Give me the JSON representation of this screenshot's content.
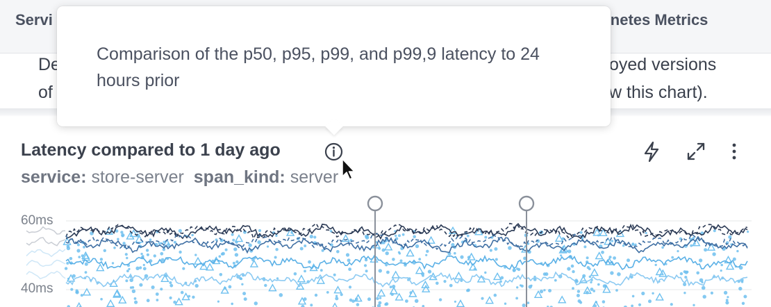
{
  "header": {
    "tab_left": "Servi",
    "tab_right": "ernetes Metrics"
  },
  "description": {
    "line1_left": "De",
    "line2_left": "of",
    "line1_right": "oyed versions",
    "line2_right": "w this chart)."
  },
  "tooltip": {
    "text": "Comparison of the p50, p95, p99, and p99,9 latency to 24 hours prior"
  },
  "panel": {
    "title": "Latency compared to 1 day ago",
    "filters": [
      {
        "key": "service:",
        "value": "store-server"
      },
      {
        "key": "span_kind:",
        "value": "server"
      }
    ],
    "icons": [
      "info-icon",
      "lightning-icon",
      "expand-icon",
      "more-vertical-icon"
    ]
  },
  "chart_data": {
    "type": "line",
    "title": "Latency compared to 1 day ago",
    "xlabel": "",
    "ylabel": "",
    "y_unit": "ms",
    "yticks": [
      "60ms",
      "40ms"
    ],
    "y_visible_range": [
      37,
      65
    ],
    "series": [
      {
        "style": "solid",
        "color": "#2b3a55",
        "mean": 57
      },
      {
        "style": "dashed",
        "color": "#2b3a55",
        "mean": 57
      },
      {
        "style": "solid",
        "color": "#3f6fa3",
        "mean": 53
      },
      {
        "style": "dashed",
        "color": "#3f6fa3",
        "mean": 54
      },
      {
        "style": "solid",
        "color": "#5ab0e6",
        "mean": 48
      },
      {
        "style": "solid",
        "color": "#8ccaf2",
        "mean": 43
      },
      {
        "style": "scatter-points",
        "color": "#6ec0ef"
      },
      {
        "style": "scatter-triangles",
        "color": "#6ec0ef"
      }
    ],
    "markers_count": 2,
    "marker_color": "#8a909a",
    "grid": true
  }
}
